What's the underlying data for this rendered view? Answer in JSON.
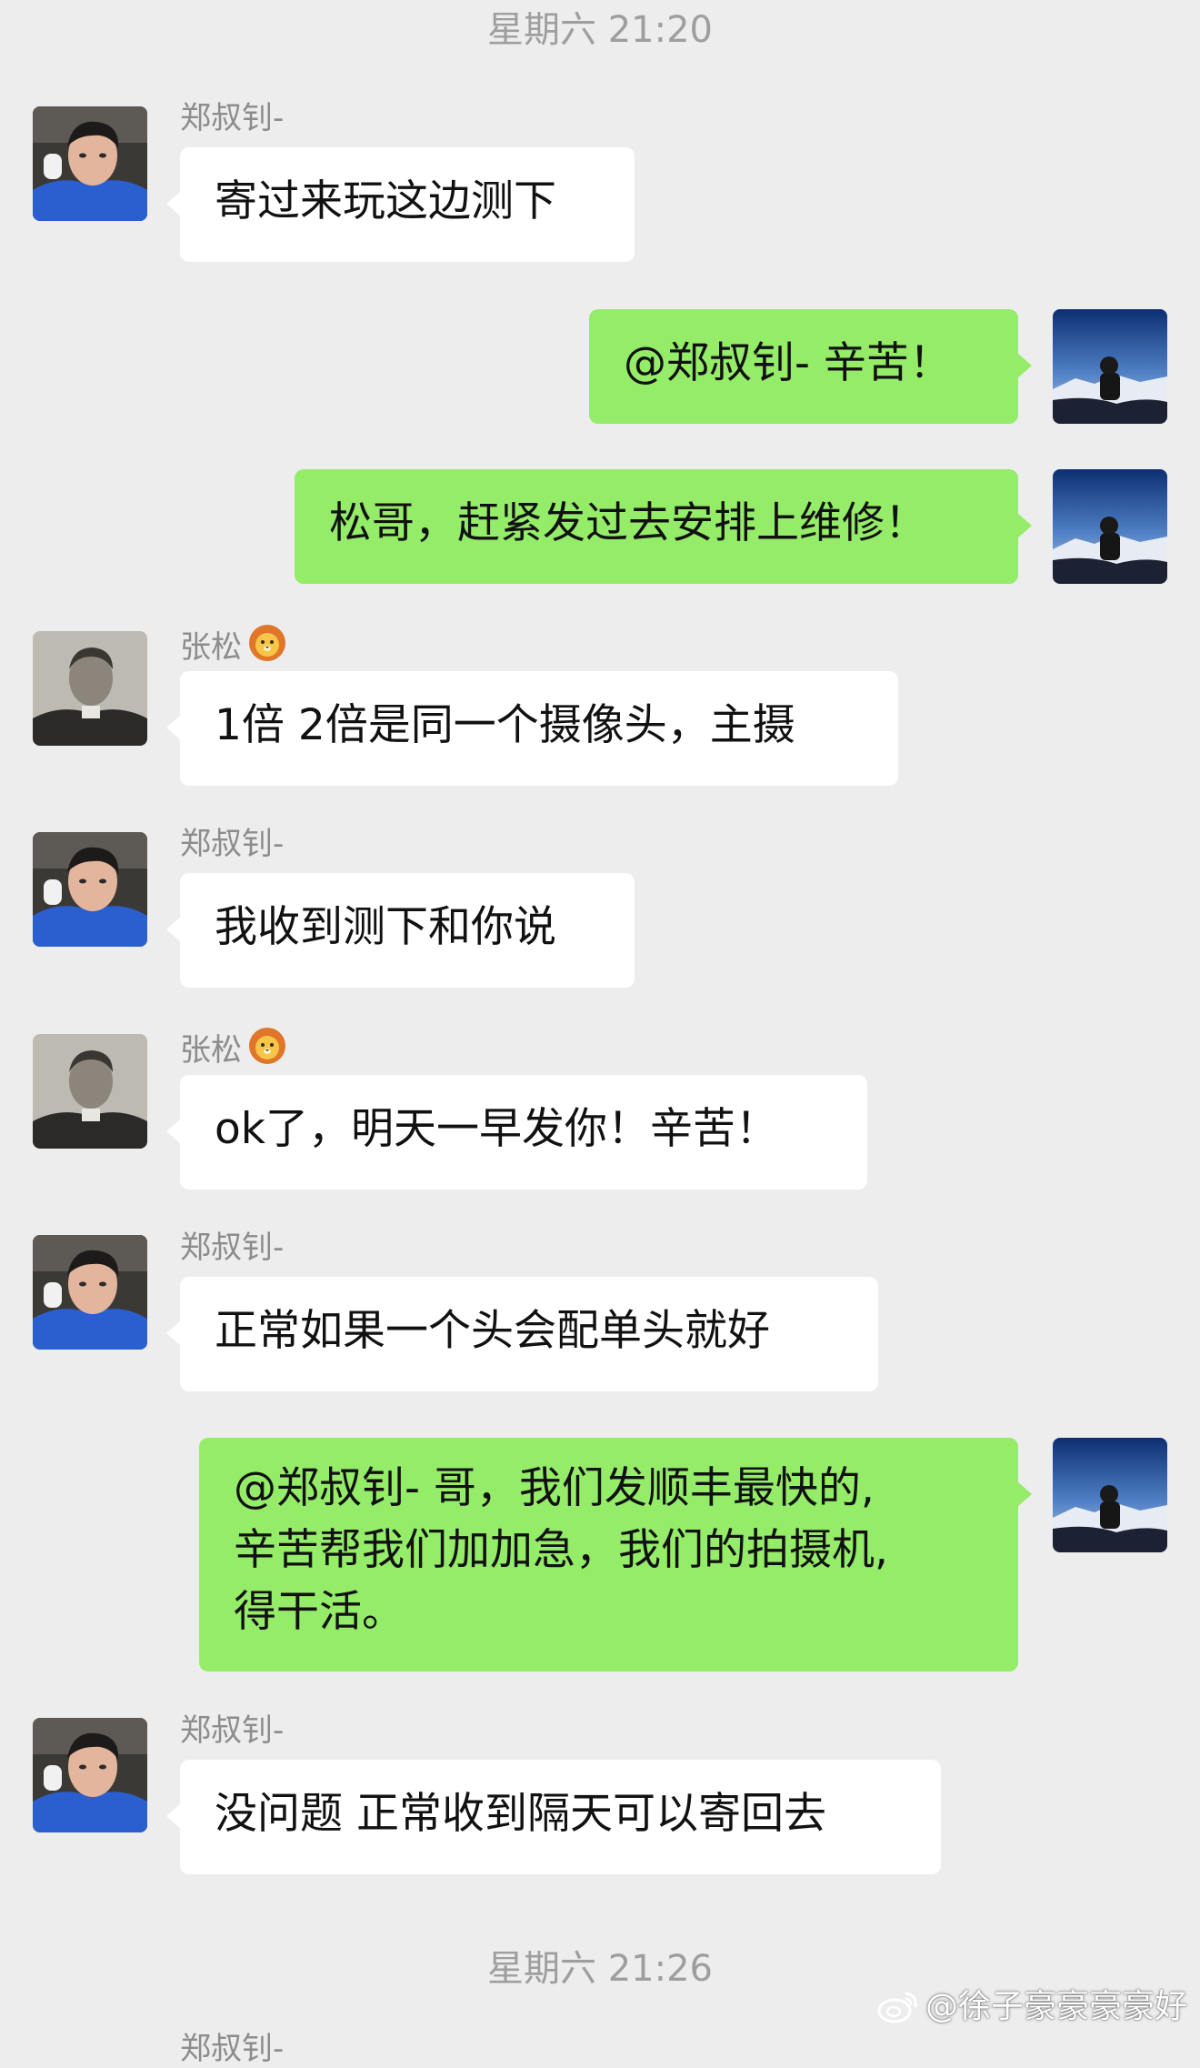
{
  "chat": {
    "timestamps": [
      "星期六 21:20",
      "星期六 21:26"
    ],
    "messages": [
      {
        "sender": "郑叔钊-",
        "text": "寄过来玩这边测下"
      },
      {
        "text": "@郑叔钊- 辛苦！"
      },
      {
        "text": "松哥，赶紧发过去安排上维修！"
      },
      {
        "sender": "张松",
        "text": "1倍 2倍是同一个摄像头，主摄"
      },
      {
        "sender": "郑叔钊-",
        "text": "我收到测下和你说"
      },
      {
        "sender": "张松",
        "text": "ok了，明天一早发你！辛苦！"
      },
      {
        "sender": "郑叔钊-",
        "text": "正常如果一个头会配单头就好"
      },
      {
        "lines": [
          "@郑叔钊- 哥，我们发顺丰最快的,",
          "辛苦帮我们加加急，我们的拍摄机,",
          "得干活。"
        ]
      },
      {
        "sender": "郑叔钊-",
        "text": "没问题 正常收到隔天可以寄回去"
      }
    ],
    "cutoff_sender": "郑叔钊-"
  },
  "watermark": {
    "text": "@徐子豪豪豪豪好"
  },
  "colors": {
    "background": "#ededed",
    "incoming_bubble": "#ffffff",
    "outgoing_bubble": "#95ec69",
    "meta_text": "#8c8c8c"
  },
  "icons": {
    "lion_emoji": "lion-face",
    "weibo_logo": "weibo-icon"
  }
}
